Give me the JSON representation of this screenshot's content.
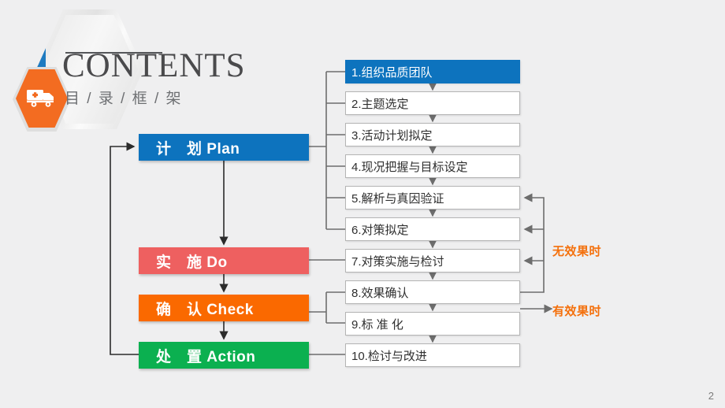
{
  "slide": {
    "page_number": "2",
    "background_color": "#efeff0"
  },
  "header": {
    "title": "CONTENTS",
    "subtitle": "目 / 录 / 框 / 架",
    "emblem_icon": "truck-icon",
    "emblem_color": "#f36c21",
    "accent_color": "#1e7ac0"
  },
  "phases": [
    {
      "label": "计　划 Plan",
      "color": "#0d73be",
      "name": "plan"
    },
    {
      "label": "实　施 Do",
      "color": "#ee6060",
      "name": "do"
    },
    {
      "label": "确　认 Check",
      "color": "#fa6900",
      "name": "check"
    },
    {
      "label": "处　置 Action",
      "color": "#0bb050",
      "name": "action"
    }
  ],
  "steps": [
    {
      "label": "1.组织品质团队",
      "highlighted": true
    },
    {
      "label": "2.主题选定",
      "highlighted": false
    },
    {
      "label": "3.活动计划拟定",
      "highlighted": false
    },
    {
      "label": "4.现况把握与目标设定",
      "highlighted": false
    },
    {
      "label": "5.解析与真因验证",
      "highlighted": false
    },
    {
      "label": "6.对策拟定",
      "highlighted": false
    },
    {
      "label": "7.对策实施与检讨",
      "highlighted": false
    },
    {
      "label": "8.效果确认",
      "highlighted": false
    },
    {
      "label": "9.标 准 化",
      "highlighted": false
    },
    {
      "label": "10.检讨与改进",
      "highlighted": false
    }
  ],
  "annotations": [
    {
      "label": "无效果时",
      "color": "#f4700c",
      "name": "no-effect-note"
    },
    {
      "label": "有效果时",
      "color": "#f4700c",
      "name": "has-effect-note"
    }
  ]
}
